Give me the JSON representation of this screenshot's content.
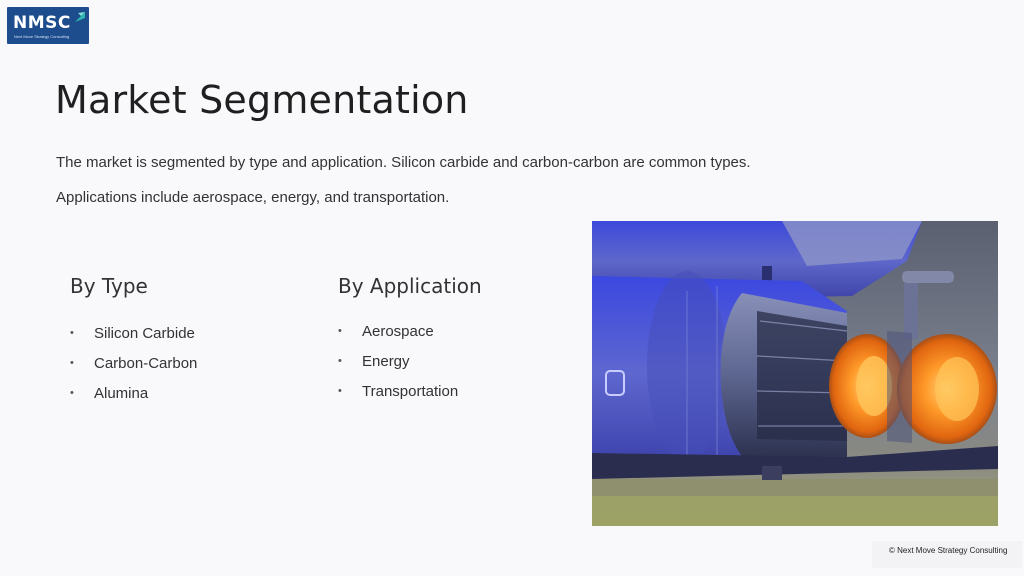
{
  "logo": {
    "text": "NMSC",
    "tagline": "Next Move Strategy Consulting"
  },
  "slide": {
    "title": "Market Segmentation",
    "intro_line_1": "The market is segmented by type and application. Silicon carbide and carbon-carbon are common types.",
    "intro_line_2": "Applications include aerospace, energy, and transportation."
  },
  "by_type": {
    "heading": "By Type",
    "items": [
      "Silicon Carbide",
      "Carbon-Carbon",
      "Alumina"
    ]
  },
  "by_application": {
    "heading": "By Application",
    "items": [
      "Aerospace",
      "Energy",
      "Transportation"
    ]
  },
  "bullet_glyph": "•",
  "footer": {
    "copyright": "© Next Move Strategy Consulting"
  },
  "colors": {
    "logo_bg": "#1d4d8c",
    "accent_teal": "#2fb8b0",
    "image_tint": "#2f3fd0",
    "afterburner": "#ff8a1e"
  }
}
